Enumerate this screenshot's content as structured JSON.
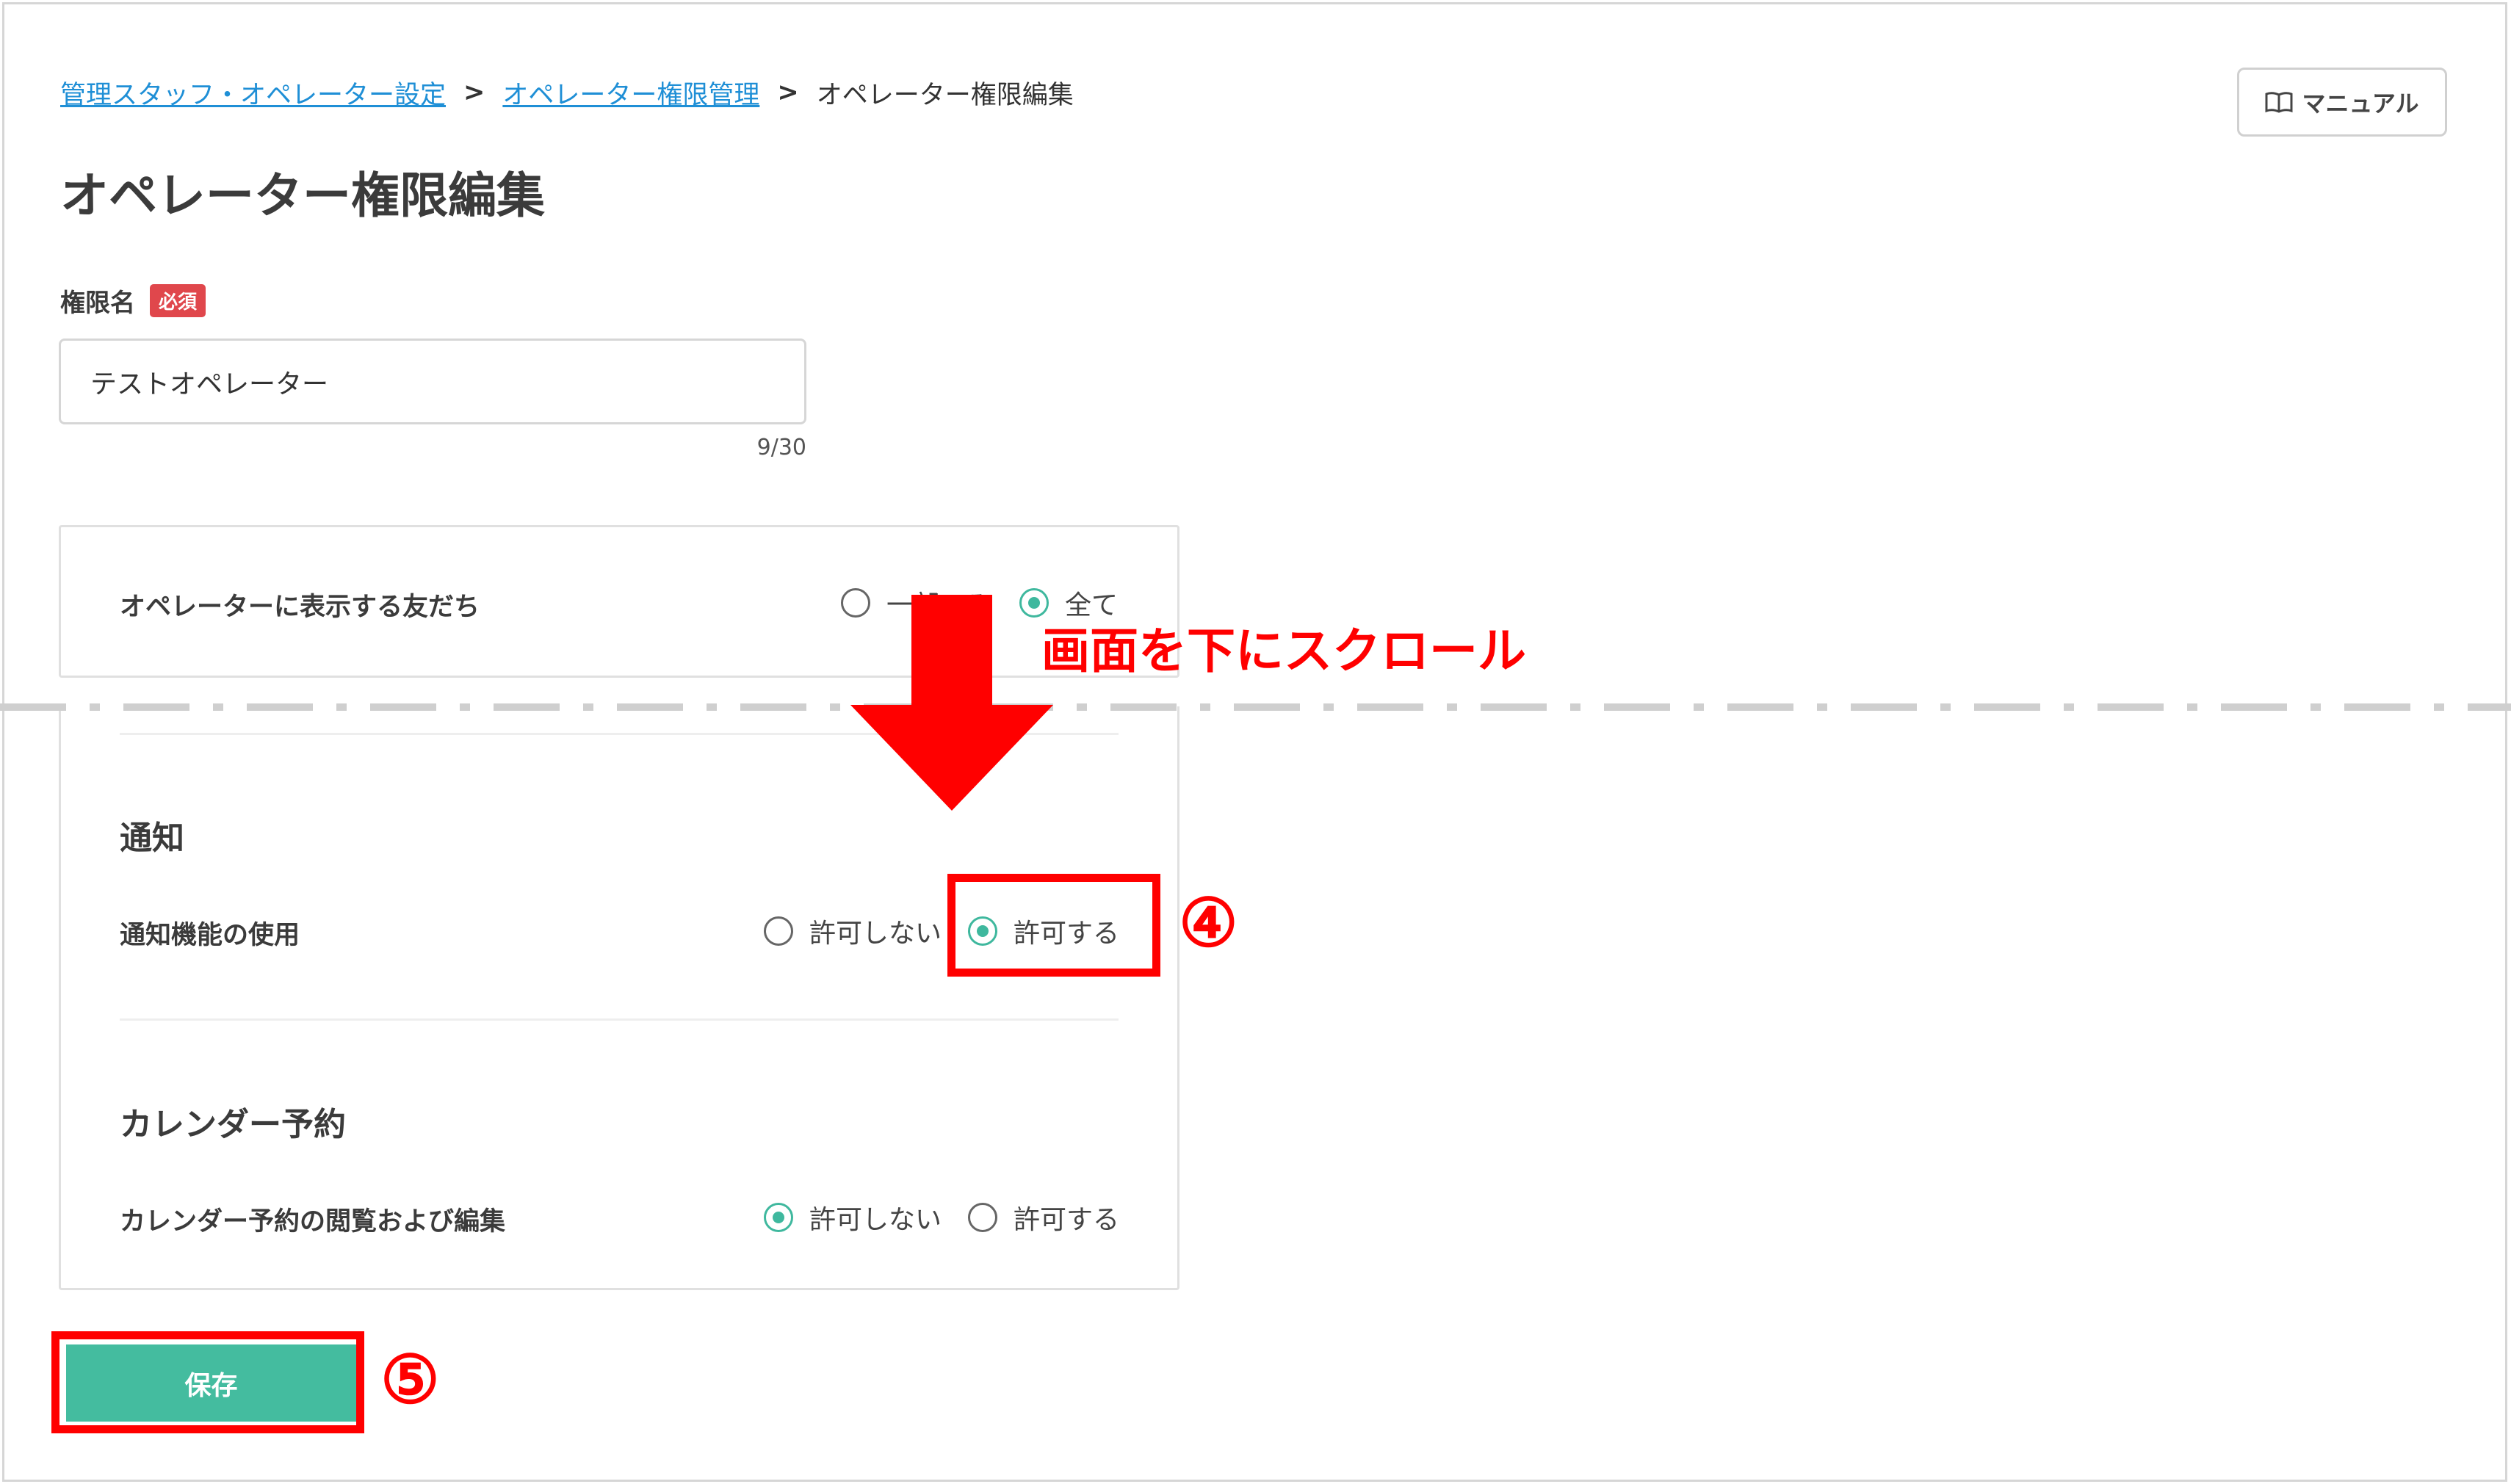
{
  "breadcrumb": {
    "link1": "管理スタッフ・オペレーター設定",
    "sep": ">",
    "link2": "オペレーター権限管理",
    "current": "オペレーター権限編集"
  },
  "header": {
    "manual_label": "マニュアル",
    "manual_icon": "book-icon"
  },
  "page_title": "オペレーター権限編集",
  "form": {
    "name_label": "権限名",
    "required_badge": "必須",
    "name_value": "テストオペレーター",
    "char_count": "9/30"
  },
  "friends_display": {
    "label": "オペレーターに表示する友だち",
    "options": [
      "一部のみ",
      "全て"
    ],
    "selected": "全て"
  },
  "notification": {
    "section_title": "通知",
    "row_label": "通知機能の使用",
    "options": [
      "許可しない",
      "許可する"
    ],
    "selected": "許可する"
  },
  "calendar": {
    "section_title": "カレンダー予約",
    "row_label": "カレンダー予約の閲覧および編集",
    "options": [
      "許可しない",
      "許可する"
    ],
    "selected": "許可しない"
  },
  "actions": {
    "save_label": "保存"
  },
  "annotations": {
    "scroll_note": "画面を下にスクロール",
    "step4": "④",
    "step5": "⑤",
    "accent_color": "#ff0000"
  },
  "colors": {
    "link": "#1f8fd6",
    "primary": "#44bc9f",
    "required": "#e0474c"
  }
}
